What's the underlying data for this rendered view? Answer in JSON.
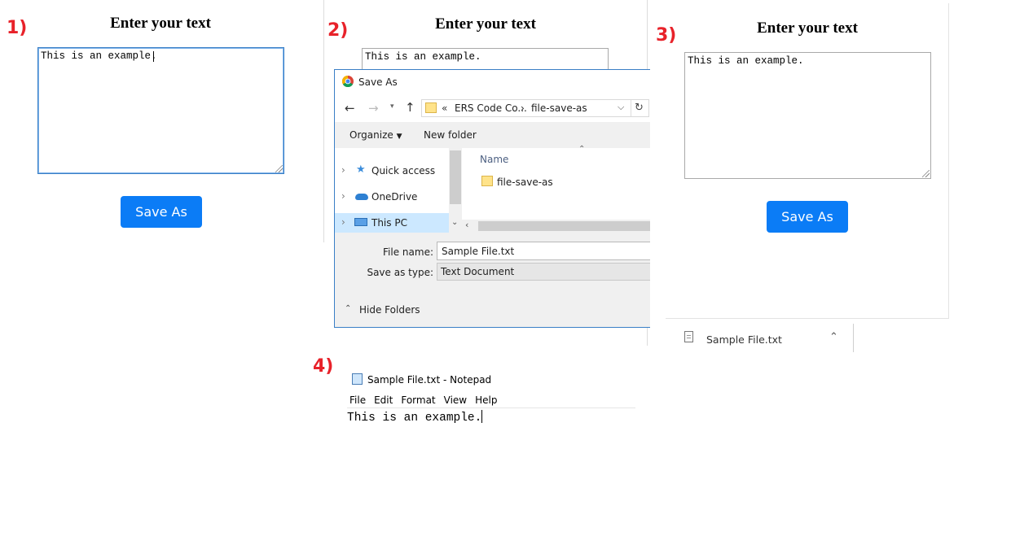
{
  "steps": [
    "1)",
    "2)",
    "3)",
    "4)"
  ],
  "app": {
    "heading": "Enter your text",
    "textarea_value": "This is an example.",
    "button_label": "Save As"
  },
  "dialog": {
    "title": "Save As",
    "breadcrumb_prefix": "«",
    "breadcrumb_1": "ERS Code Co...",
    "breadcrumb_sep": "›",
    "breadcrumb_2": "file-save-as",
    "organize": "Organize",
    "new_folder": "New folder",
    "nav_items": [
      "Quick access",
      "OneDrive",
      "This PC"
    ],
    "column_name": "Name",
    "files": [
      "file-save-as"
    ],
    "file_name_label": "File name:",
    "file_name_value": "Sample File.txt",
    "save_type_label": "Save as type:",
    "save_type_value": "Text Document",
    "hide_folders": "Hide Folders"
  },
  "download": {
    "file_name": "Sample File.txt"
  },
  "notepad": {
    "title": "Sample File.txt - Notepad",
    "menu": [
      "File",
      "Edit",
      "Format",
      "View",
      "Help"
    ],
    "content": "This is an example."
  },
  "colors": {
    "accent": "#0b7cf6",
    "step_label": "#e8222a",
    "focus_border": "#3a7fc6"
  }
}
